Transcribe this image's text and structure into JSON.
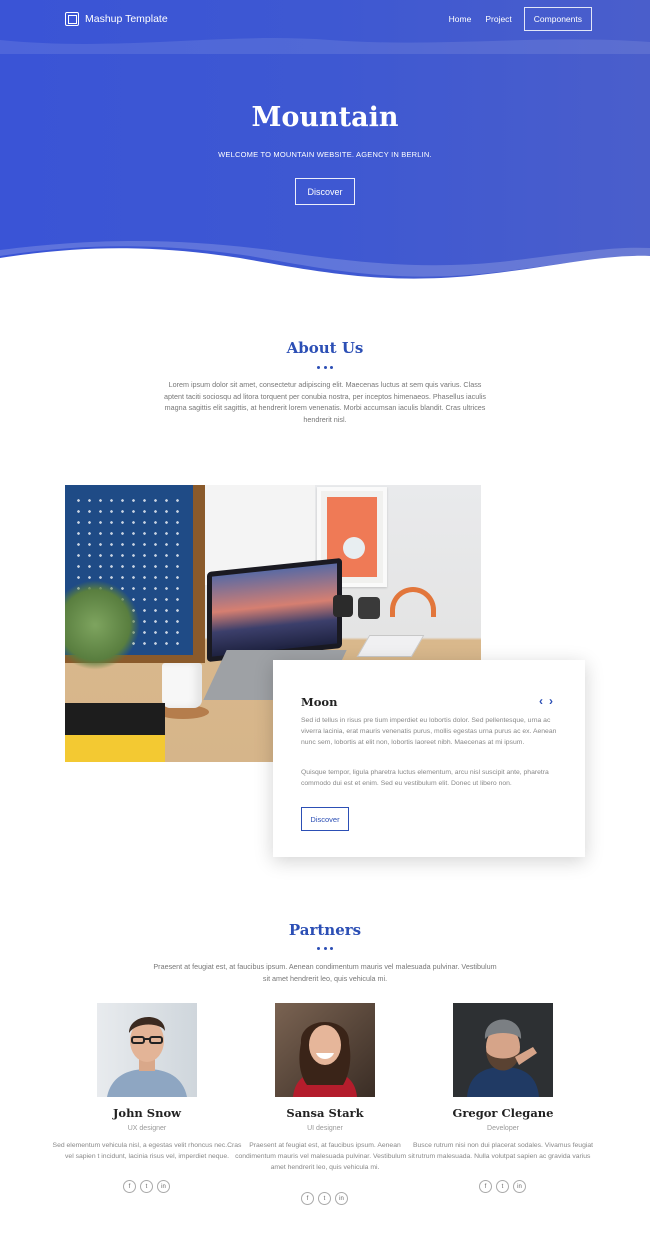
{
  "nav": {
    "brand": "Mashup Template",
    "links": [
      {
        "label": "Home"
      },
      {
        "label": "Project"
      },
      {
        "label": "Components"
      }
    ]
  },
  "hero": {
    "title": "Mountain",
    "subtitle": "WELCOME TO MOUNTAIN WEBSITE. AGENCY IN BERLIN.",
    "button": "Discover"
  },
  "about": {
    "title": "About Us",
    "text": "Lorem ipsum dolor sit amet, consectetur adipiscing elit. Maecenas luctus at sem quis varius. Class aptent taciti sociosqu ad litora torquent per conubia nostra, per inceptos himenaeos. Phasellus iaculis magna sagittis elit sagittis, at hendrerit lorem venenatis. Morbi accumsan iaculis blandit. Cras ultrices hendrerit nisl."
  },
  "card": {
    "title": "Moon",
    "prev": "‹",
    "next": "›",
    "p1": "Sed id tellus in risus pre tium imperdiet eu lobortis dolor. Sed pellentesque, urna ac viverra lacinia, erat mauris venenatis purus, mollis egestas urna purus ac ex. Aenean nunc sem, lobortis at elit non, lobortis laoreet nibh. Maecenas at mi ipsum.",
    "p2": "Quisque tempor, ligula pharetra luctus elementum, arcu nisl suscipit ante, pharetra commodo dui est et enim. Sed eu vestibulum elit. Donec ut libero non.",
    "button": "Discover"
  },
  "partners": {
    "title": "Partners",
    "text": "Praesent at feugiat est, at faucibus ipsum. Aenean condimentum mauris vel malesuada pulvinar. Vestibulum sit amet hendrerit leo, quis vehicula mi.",
    "members": [
      {
        "name": "John Snow",
        "role": "UX designer",
        "text": "Sed elementum vehicula nisl, a egestas velit rhoncus nec.Cras vel sapien t incidunt, lacinia risus vel, imperdiet neque."
      },
      {
        "name": "Sansa Stark",
        "role": "UI designer",
        "text": "Praesent at feugiat est, at faucibus ipsum. Aenean condimentum mauris vel malesuada pulvinar. Vestibulum sit amet hendrerit leo, quis vehicula mi."
      },
      {
        "name": "Gregor Clegane",
        "role": "Developer",
        "text": "Busce rutrum nisi non dui placerat sodales. Vivamus feugiat rutrum malesuada. Nulla volutpat sapien ac gravida varius"
      }
    ],
    "social": {
      "facebook": "f",
      "twitter": "t",
      "linkedin": "in"
    }
  },
  "colors": {
    "hero": "#3e58d2",
    "accent": "#2c4fb5"
  }
}
